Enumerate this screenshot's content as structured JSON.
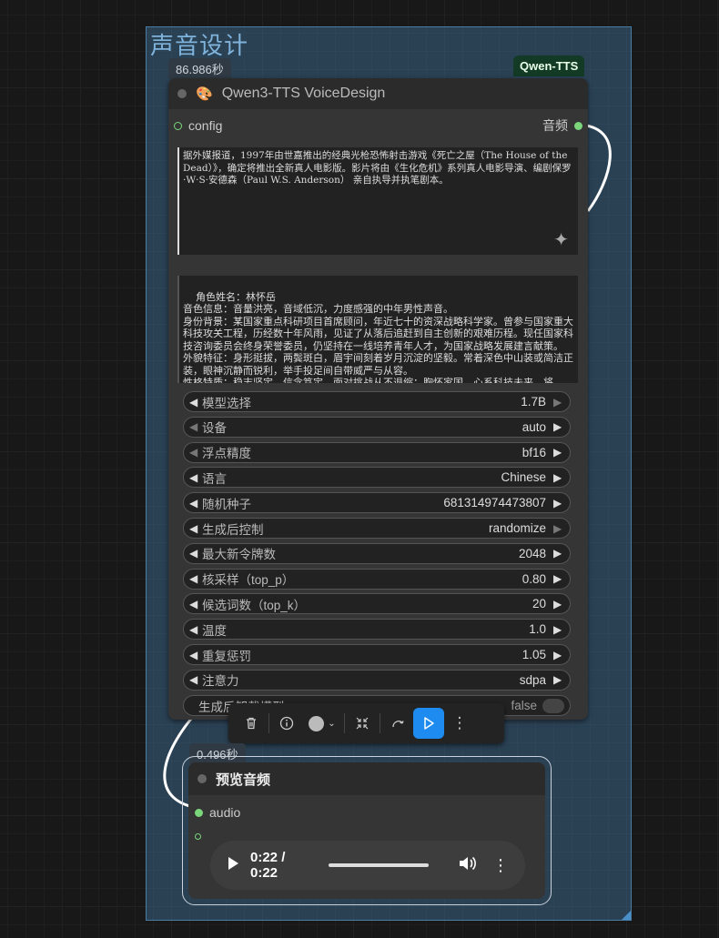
{
  "group": {
    "title": "声音设计"
  },
  "tts_node": {
    "exec_time": "86.986秒",
    "badge": "Qwen-TTS",
    "emoji": "🎨",
    "title": "Qwen3-TTS VoiceDesign",
    "input_label": "config",
    "output_label": "音频",
    "text_prompt": "据外媒报道，1997年由世嘉推出的经典光枪恐怖射击游戏《死亡之屋（The House of the Dead）》，确定将推出全新真人电影版。影片将由《生化危机》系列真人电影导演、编剧保罗·W·S·安德森（Paul W.S. Anderson） 亲自执导并执笔剧本。",
    "voice_prompt": "角色姓名：林怀岳\n音色信息：音量洪亮，音域低沉，力度感强的中年男性声音。\n身份背景：某国家重点科研项目首席顾问，年近七十的资深战略科学家。曾参与国家重大科技攻关工程，历经数十年风雨，见证了从落后追赶到自主创新的艰难历程。现任国家科技咨询委员会终身荣誉委员，仍坚持在一线培养青年人才，为国家战略发展建言献策。\n外貌特征：身形挺拔，两鬓斑白，眉宇间刻着岁月沉淀的坚毅。常着深色中山装或简洁正装，眼神沉静而锐利，举手投足间自带威严与从容。\n性格特质：稳志坚定，信念笃定，面对挑战从不退缩；胸怀家国，心系科技未来，将",
    "widgets": [
      {
        "label": "模型选择",
        "value": "1.7B",
        "left_dim": false,
        "right_dim": true
      },
      {
        "label": "设备",
        "value": "auto",
        "left_dim": true,
        "right_dim": false
      },
      {
        "label": "浮点精度",
        "value": "bf16",
        "left_dim": true,
        "right_dim": false
      },
      {
        "label": "语言",
        "value": "Chinese",
        "left_dim": false,
        "right_dim": false
      },
      {
        "label": "随机种子",
        "value": "681314974473807",
        "left_dim": false,
        "right_dim": false
      },
      {
        "label": "生成后控制",
        "value": "randomize",
        "left_dim": false,
        "right_dim": true
      },
      {
        "label": "最大新令牌数",
        "value": "2048",
        "left_dim": false,
        "right_dim": false
      },
      {
        "label": "核采样（top_p）",
        "value": "0.80",
        "left_dim": false,
        "right_dim": false
      },
      {
        "label": "候选词数（top_k）",
        "value": "20",
        "left_dim": false,
        "right_dim": false
      },
      {
        "label": "温度",
        "value": "1.0",
        "left_dim": false,
        "right_dim": false
      },
      {
        "label": "重复惩罚",
        "value": "1.05",
        "left_dim": false,
        "right_dim": false
      },
      {
        "label": "注意力",
        "value": "sdpa",
        "left_dim": false,
        "right_dim": false
      }
    ],
    "toggle_widget": {
      "label": "生成后卸载模型",
      "value": "false"
    }
  },
  "preview_node": {
    "exec_time": "0.496秒",
    "title": "预览音频",
    "input_label": "audio",
    "time_display": "0:22 / 0:22"
  },
  "icons": {
    "trash": "trash-icon",
    "info": "info-icon",
    "color": "color-circle-icon",
    "collapse": "collapse-icon",
    "bypass": "bypass-icon",
    "run": "play-icon",
    "more": "more-icon"
  }
}
